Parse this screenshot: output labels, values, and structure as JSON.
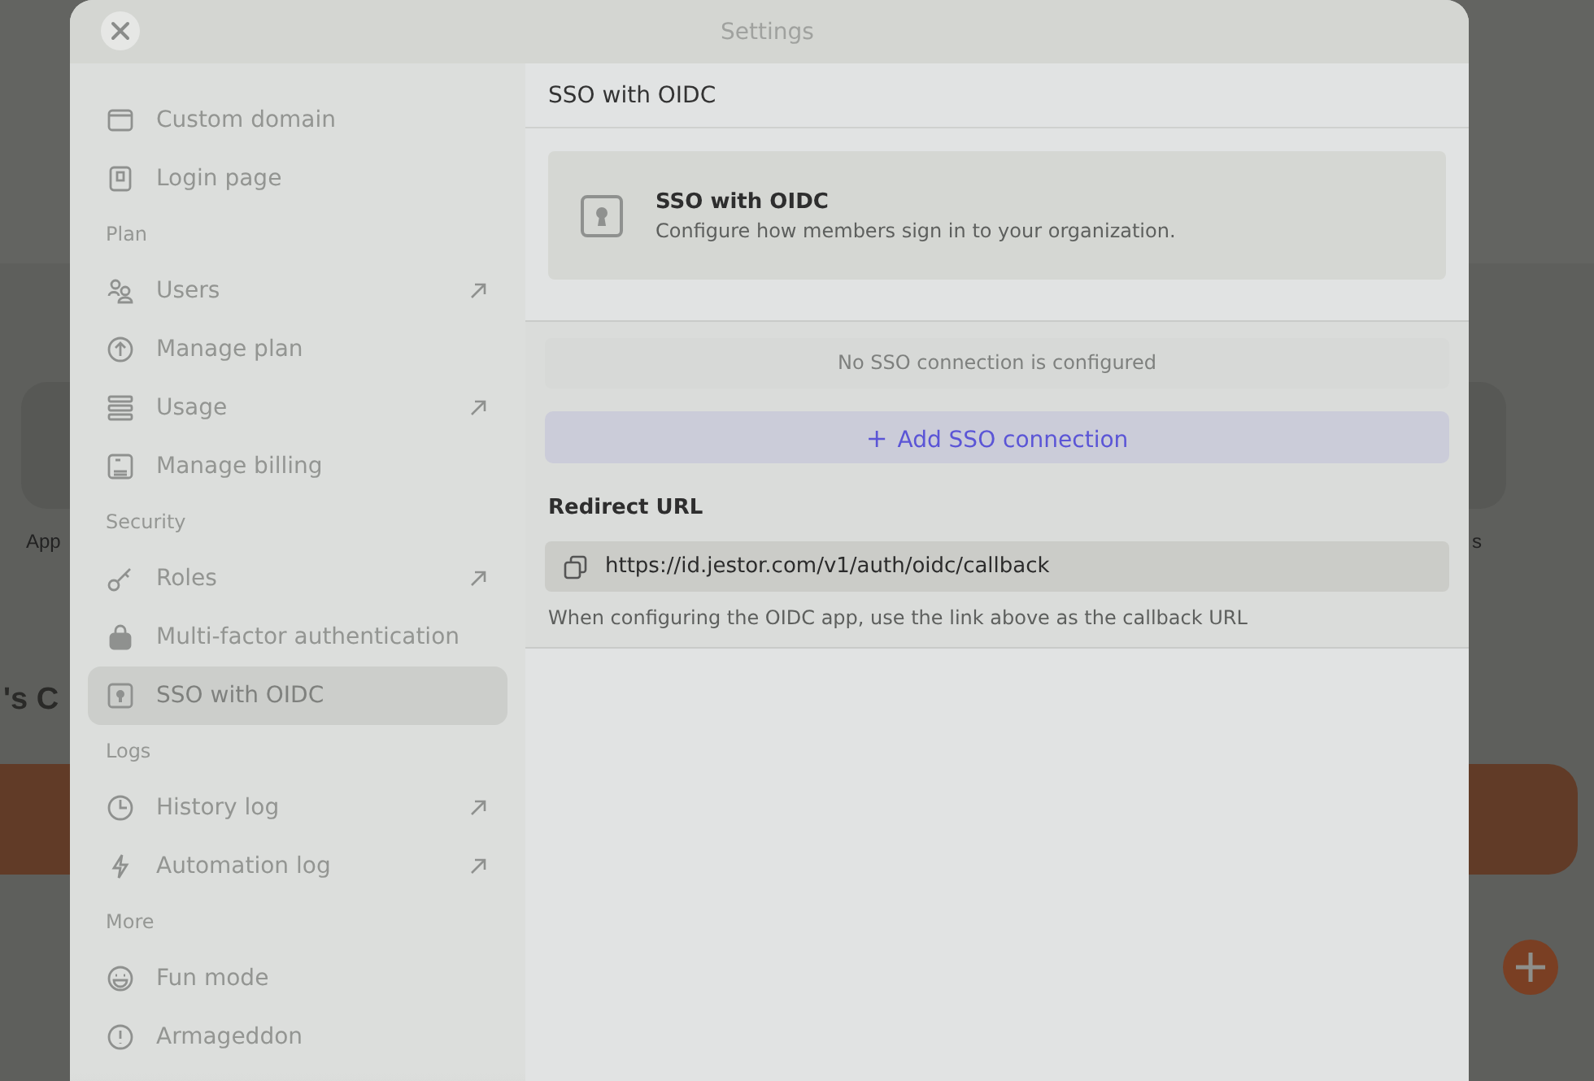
{
  "background": {
    "tile_label": "App",
    "tile_label_right": "s",
    "heading": "'s C"
  },
  "dialog": {
    "title": "Settings"
  },
  "sidebar": {
    "sections": [
      {
        "items": [
          {
            "label": "Custom domain",
            "external": false,
            "selected": false
          },
          {
            "label": "Login page",
            "external": false,
            "selected": false
          }
        ]
      },
      {
        "title": "Plan",
        "items": [
          {
            "label": "Users",
            "external": true,
            "selected": false
          },
          {
            "label": "Manage plan",
            "external": false,
            "selected": false
          },
          {
            "label": "Usage",
            "external": true,
            "selected": false
          },
          {
            "label": "Manage billing",
            "external": false,
            "selected": false
          }
        ]
      },
      {
        "title": "Security",
        "items": [
          {
            "label": "Roles",
            "external": true,
            "selected": false
          },
          {
            "label": "Multi-factor authentication",
            "external": false,
            "selected": false
          },
          {
            "label": "SSO with OIDC",
            "external": false,
            "selected": true
          }
        ]
      },
      {
        "title": "Logs",
        "items": [
          {
            "label": "History log",
            "external": true,
            "selected": false
          },
          {
            "label": "Automation log",
            "external": true,
            "selected": false
          }
        ]
      },
      {
        "title": "More",
        "items": [
          {
            "label": "Fun mode",
            "external": false,
            "selected": false
          },
          {
            "label": "Armageddon",
            "external": false,
            "selected": false
          }
        ]
      }
    ]
  },
  "content": {
    "title": "SSO with OIDC",
    "info_card": {
      "title": "SSO with OIDC",
      "description": "Configure how members sign in to your organization."
    },
    "empty_message": "No SSO connection is configured",
    "add_button": {
      "icon": "+",
      "label": "Add SSO connection"
    },
    "redirect": {
      "label": "Redirect URL",
      "url": "https://id.jestor.com/v1/auth/oidc/callback",
      "hint": "When configuring the OIDC app, use the link above as the callback URL"
    }
  }
}
